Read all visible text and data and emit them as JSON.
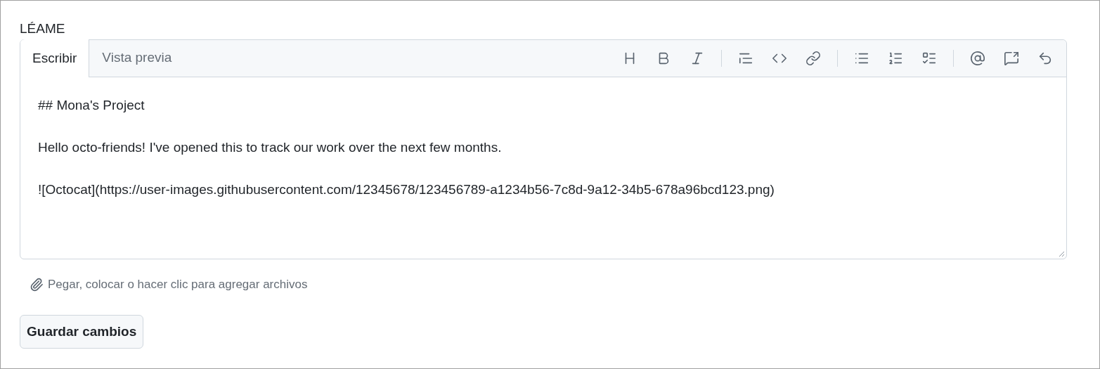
{
  "label": "LÉAME",
  "tabs": [
    {
      "label": "Escribir",
      "selected": true
    },
    {
      "label": "Vista previa",
      "selected": false
    }
  ],
  "editor": {
    "paragraphs": [
      "## Mona's Project",
      "Hello octo-friends! I've opened this to track our work over the next few months.",
      "![Octocat](https://user-images.githubusercontent.com/12345678/123456789-a1234b56-7c8d-9a12-34b5-678a96bcd123.png)"
    ]
  },
  "attach_hint": "Pegar, colocar o hacer clic para agregar archivos",
  "save_button": "Guardar cambios"
}
